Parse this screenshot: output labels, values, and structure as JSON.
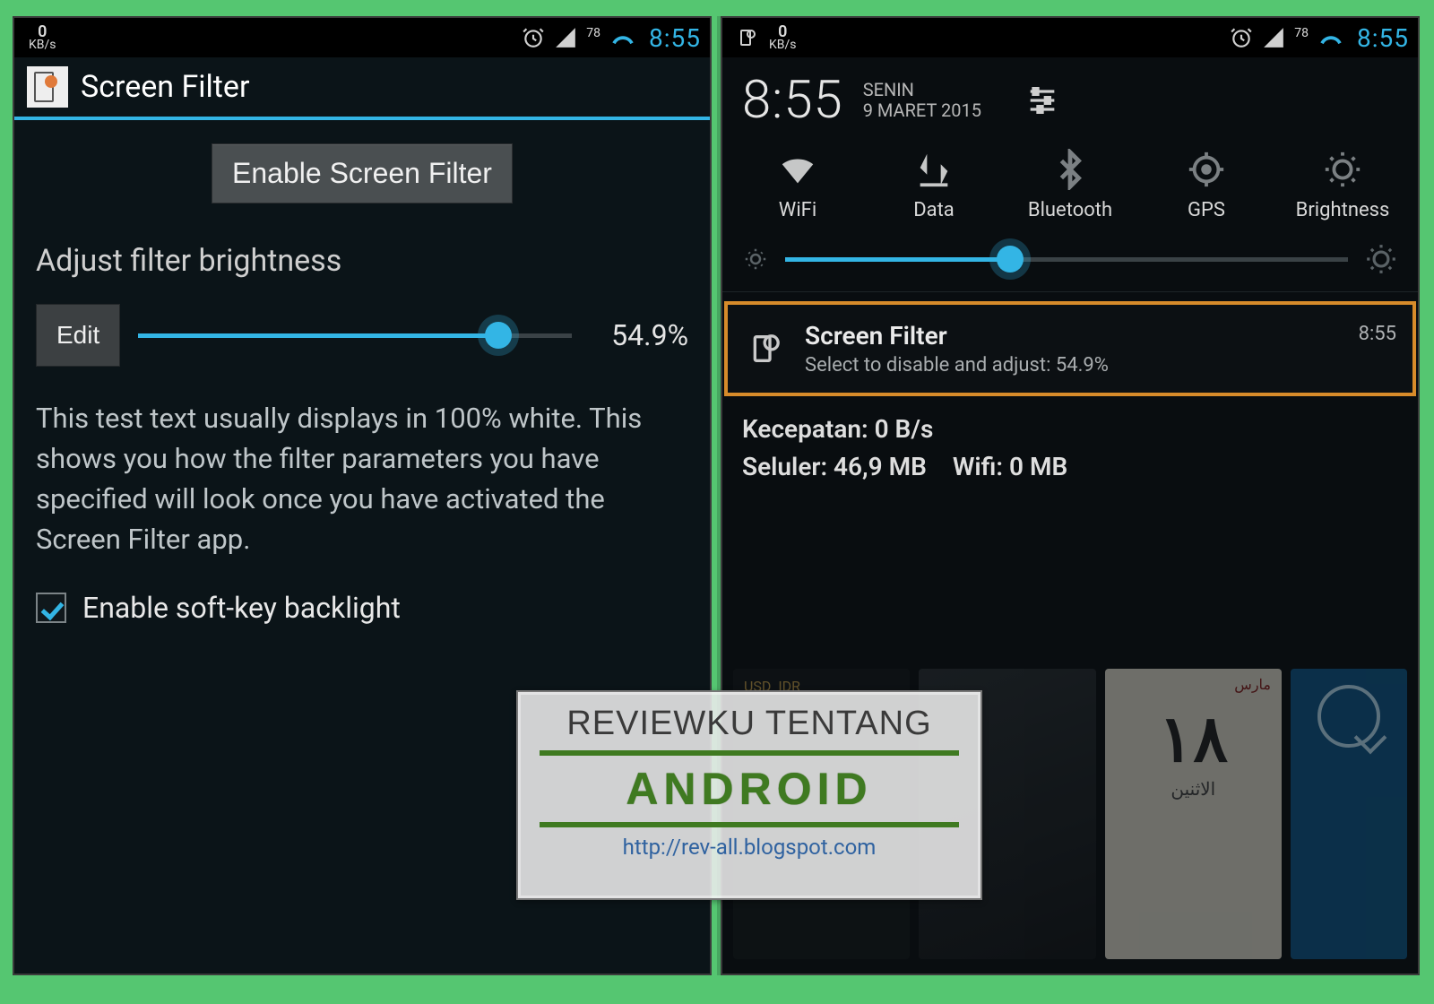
{
  "statusbar": {
    "speed_value": "0",
    "speed_unit": "KB/s",
    "battery_pct": "78",
    "time": "8:55"
  },
  "left": {
    "app_title": "Screen Filter",
    "enable_button": "Enable Screen Filter",
    "section_title": "Adjust filter brightness",
    "edit_button": "Edit",
    "brightness_pct": "54.9%",
    "slider_fill_pct": 83,
    "test_text": "This test text usually displays in 100% white. This shows you how the filter parameters you have specified will look once you have activated the Screen Filter app.",
    "checkbox_label": "Enable soft-key backlight",
    "checkbox_checked": true
  },
  "right": {
    "big_time": "8:55",
    "day": "SENIN",
    "date": "9 MARET 2015",
    "toggles": [
      {
        "label": "WiFi"
      },
      {
        "label": "Data"
      },
      {
        "label": "Bluetooth"
      },
      {
        "label": "GPS"
      },
      {
        "label": "Brightness"
      }
    ],
    "brightness_slider_fill_pct": 40,
    "notification": {
      "title": "Screen Filter",
      "subtitle": "Select to disable and adjust: 54.9%",
      "time": "8:55"
    },
    "speed": {
      "line1": "Kecepatan: 0 B/s",
      "line2a": "Seluler: 46,9 MB",
      "line2b": "Wifi: 0 MB"
    },
    "calendar_widget": {
      "arabic": "مارس",
      "number": "١٨",
      "sub": "الاثنين"
    },
    "currency_widget": {
      "usd": "USD",
      "idr": "IDR"
    }
  },
  "watermark": {
    "line1": "REVIEWKU TENTANG",
    "line2": "ANDROID",
    "url": "http://rev-all.blogspot.com"
  }
}
